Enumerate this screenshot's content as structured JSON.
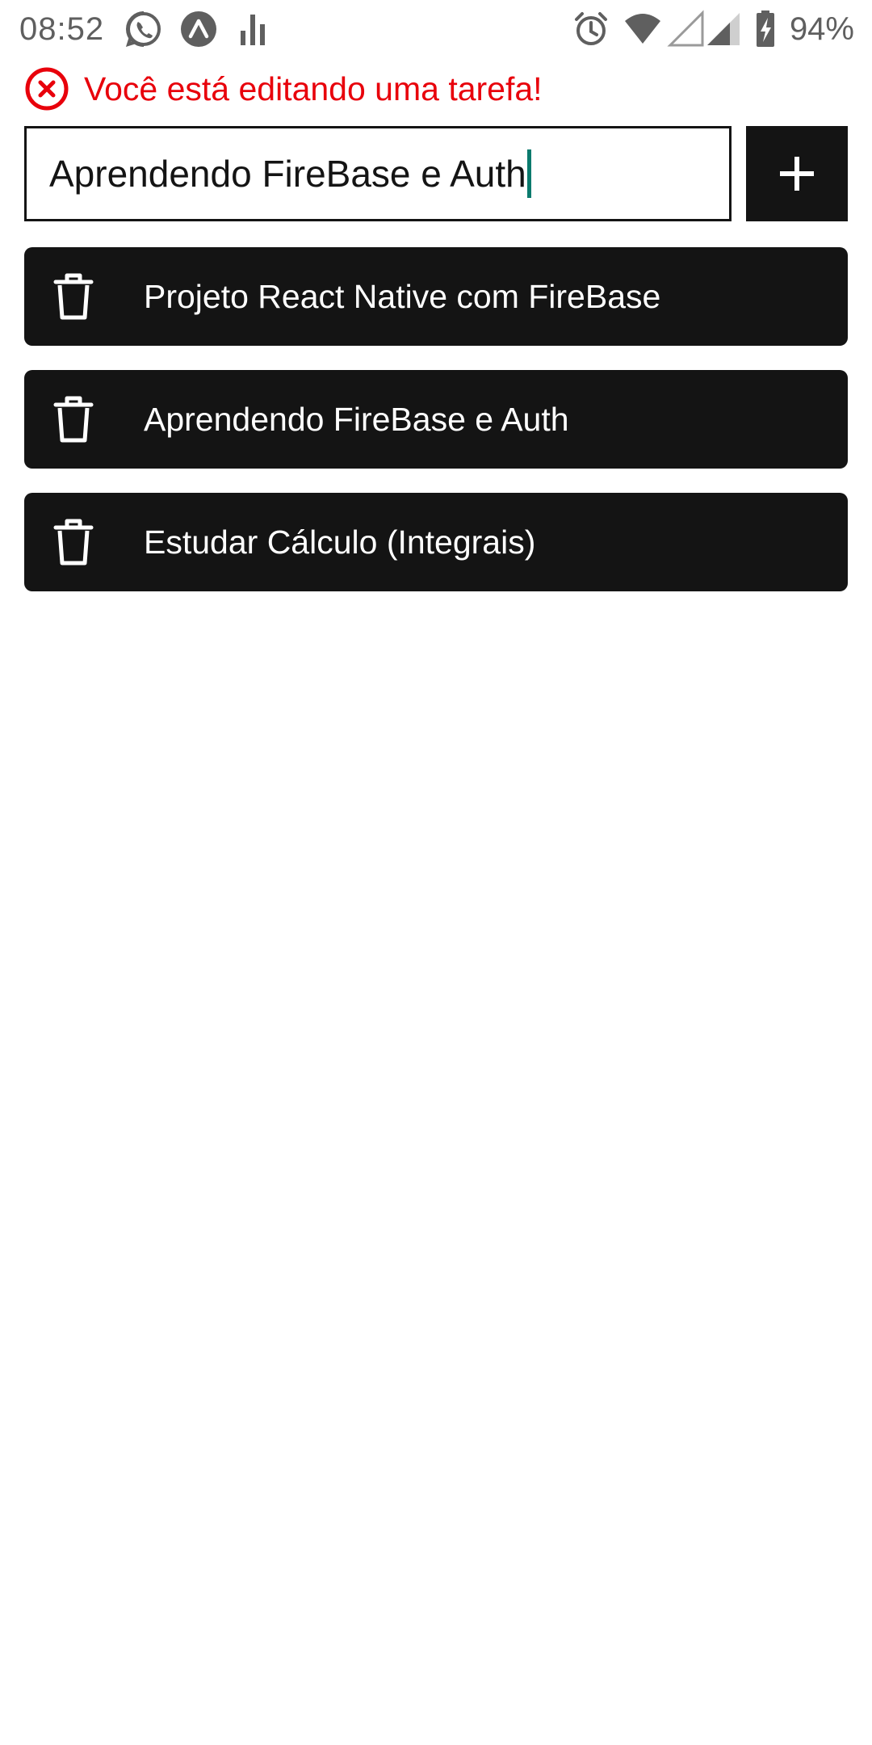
{
  "status_bar": {
    "time": "08:52",
    "battery_percent": "94%",
    "icons_left": [
      "whatsapp-icon",
      "expo-icon",
      "signal-bars-icon"
    ],
    "icons_right": [
      "alarm-icon",
      "wifi-icon",
      "cell-signal-empty-icon",
      "cell-signal-icon",
      "battery-charging-icon"
    ]
  },
  "banner": {
    "message": "Você está editando uma tarefa!",
    "icon": "error-circle-icon",
    "color": "#e8000b"
  },
  "input": {
    "value": "Aprendendo FireBase e Auth",
    "caret_color": "#0b7a6d"
  },
  "add_button": {
    "label": "+",
    "icon": "plus-icon"
  },
  "tasks": [
    {
      "label": "Projeto React Native com FireBase",
      "icon": "trash-icon"
    },
    {
      "label": "Aprendendo FireBase e Auth",
      "icon": "trash-icon"
    },
    {
      "label": "Estudar Cálculo (Integrais)",
      "icon": "trash-icon"
    }
  ],
  "colors": {
    "card_background": "#141414",
    "card_text": "#ffffff",
    "status_text": "#5f5f5f"
  }
}
